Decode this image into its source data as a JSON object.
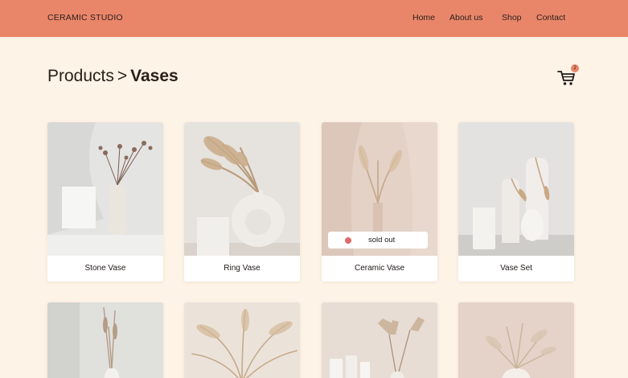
{
  "header": {
    "brand": "CERAMIC STUDIO",
    "nav": [
      {
        "label": "Home"
      },
      {
        "label": "About us"
      },
      {
        "label": "Shop"
      },
      {
        "label": "Contact"
      }
    ],
    "background": "#e9866a"
  },
  "breadcrumb": {
    "parent": "Products",
    "separator": ">",
    "current": "Vases"
  },
  "cart": {
    "icon": "cart-icon",
    "count": "2"
  },
  "products": [
    {
      "name": "Stone Vase"
    },
    {
      "name": "Ring Vase"
    },
    {
      "name": "Ceramic Vase",
      "status": "sold out"
    },
    {
      "name": "Vase Set"
    }
  ],
  "colors": {
    "page_background": "#fdf3e6",
    "accent": "#e9866a",
    "sold_out_dot": "#e06a6a"
  }
}
